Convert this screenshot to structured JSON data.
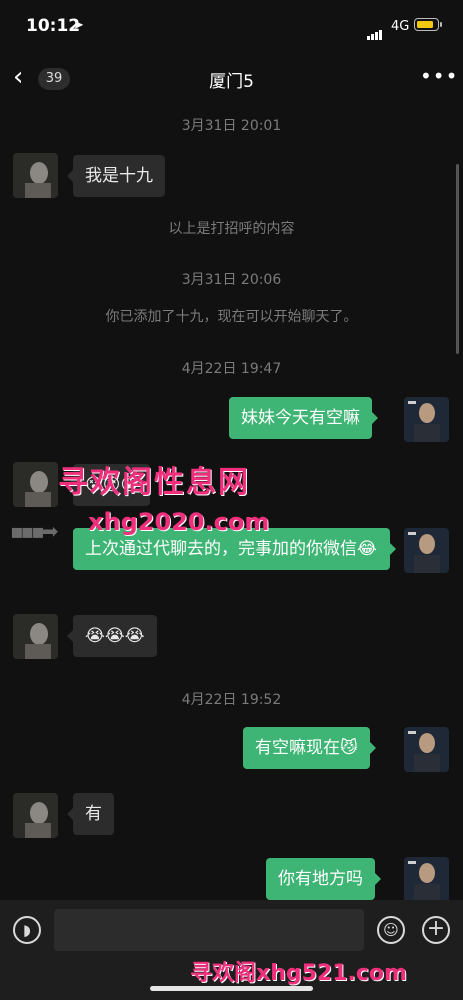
{
  "status": {
    "time": "10:12",
    "network": "4G",
    "battery_color": "#f2c811"
  },
  "nav": {
    "back_glyph": "‹",
    "unread_count": "39",
    "title": "厦门5",
    "more_glyph": "•••"
  },
  "messages": {
    "ts1": "3月31日 20:01",
    "m1": "我是十九",
    "sys1": "以上是打招呼的内容",
    "ts2": "3月31日 20:06",
    "sys2": "你已添加了十九，现在可以开始聊天了。",
    "ts3": "4月22日 19:47",
    "m2": "妹妹今天有空嘛",
    "m3": "😵😵😵",
    "m4": "上次通过代聊去的，完事加的你微信😂",
    "m5": "😭😭😭",
    "ts4": "4月22日 19:52",
    "m6": "有空嘛现在😼",
    "m7": "有",
    "m8": "你有地方吗"
  },
  "watermarks": {
    "top": "寻欢阁性息网",
    "mid": "xhg2020.com",
    "bottom": "寻欢阁xhg521.com"
  },
  "colors": {
    "green_bubble": "#3eb575",
    "gray_bubble": "#2c2c2c",
    "watermark": "#ef2f7c"
  }
}
